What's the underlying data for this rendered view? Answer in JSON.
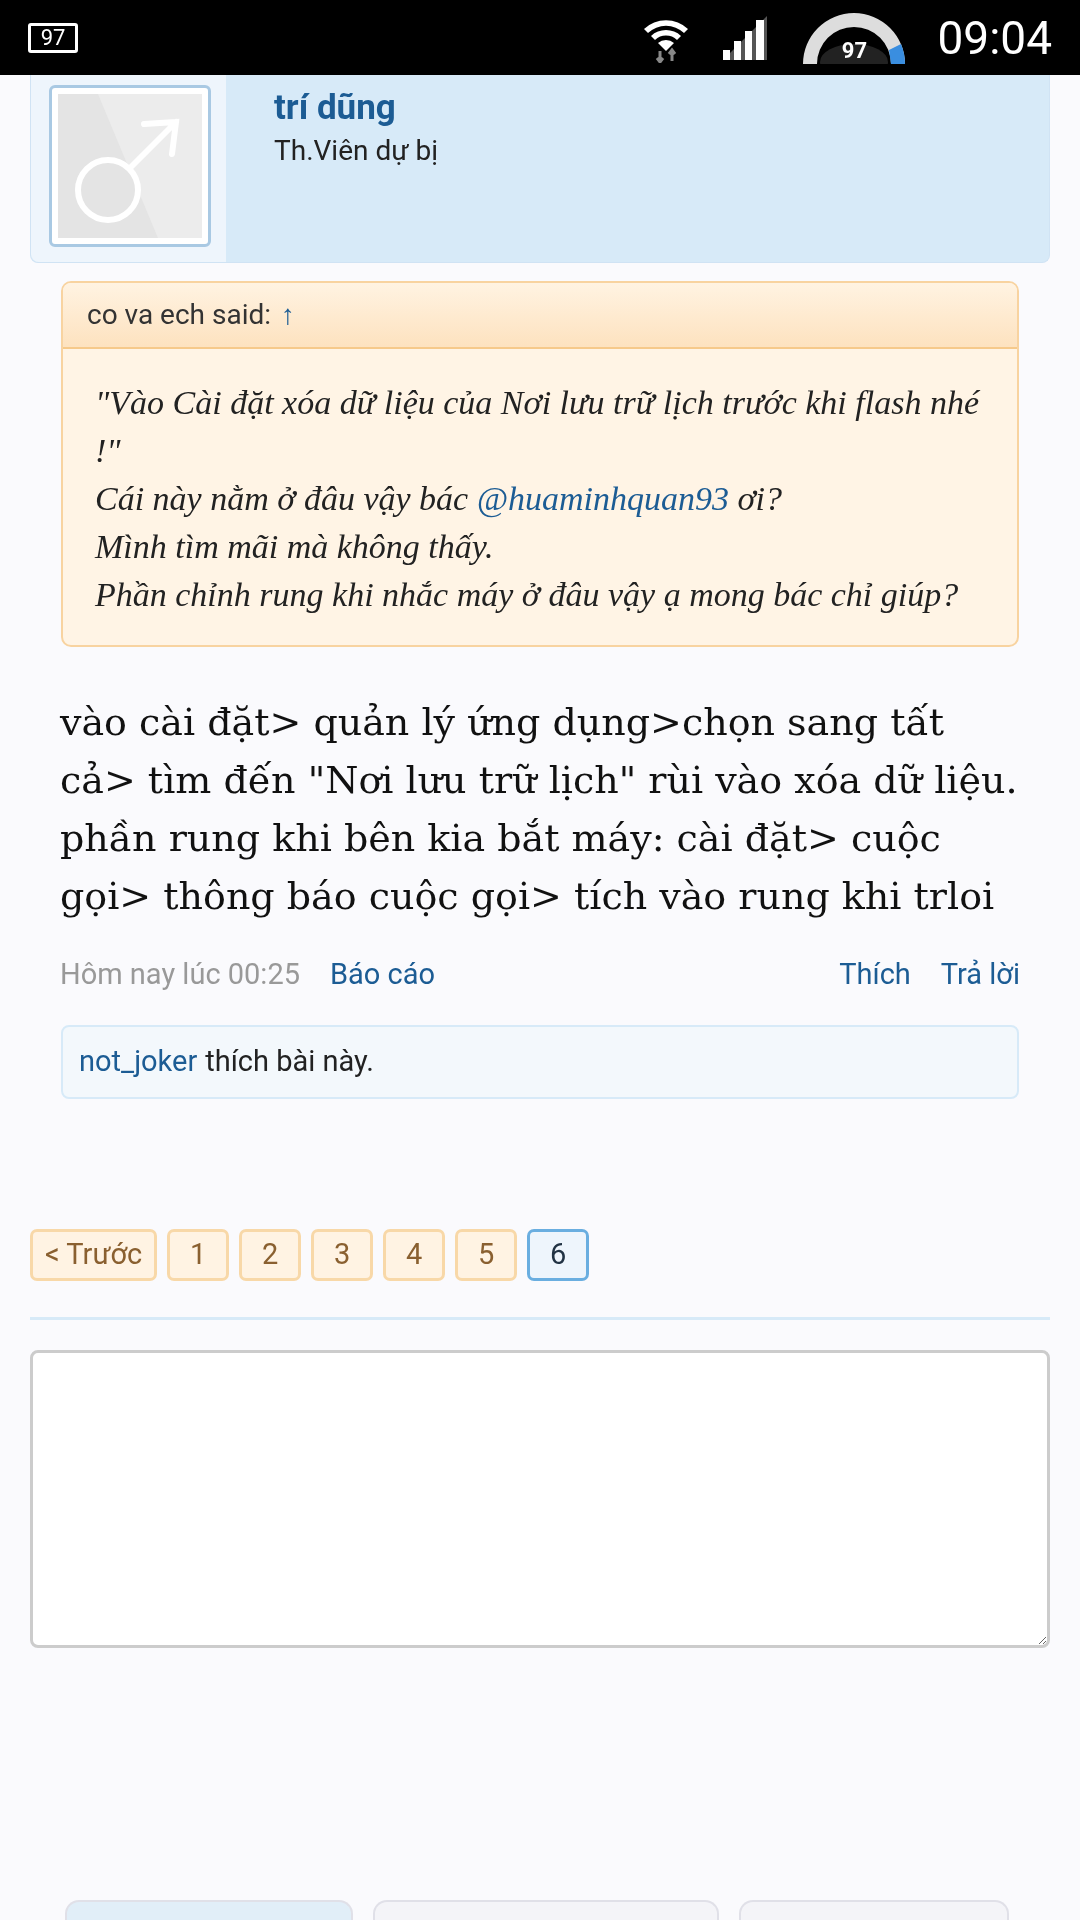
{
  "status_bar": {
    "battery": "97",
    "gauge": "97",
    "time": "09:04"
  },
  "author": {
    "name": "trí dũng",
    "title": "Th.Viên dự bị"
  },
  "quote": {
    "header": "co va ech said:",
    "jump": "↑",
    "lines": [
      "\"Vào Cài đặt xóa dữ liệu của Nơi lưu trữ lịch trước khi flash nhé !\""
    ],
    "mention_before": "Cái này nằm ở đâu vậy bác",
    "mention": "@huaminhquan93",
    "mention_after": "ơi?",
    "rest": [
      "Mình tìm mãi mà không thấy.",
      "Phần chỉnh rung khi nhắc máy ở đâu vậy ạ mong bác chỉ giúp?"
    ]
  },
  "message": [
    "vào cài đặt> quản lý ứng dụng>chọn sang tất cả> tìm đến \"Nơi lưu trữ lịch\" rùi vào xóa dữ liệu.",
    "phần rung khi bên kia bắt máy: cài đặt> cuộc gọi> thông báo cuộc gọi> tích vào rung khi trloi"
  ],
  "meta": {
    "date": "Hôm nay lúc 00:25",
    "report": "Báo cáo",
    "like": "Thích",
    "reply": "Trả lời"
  },
  "likes": {
    "user": "not_joker",
    "text": "thích bài này."
  },
  "pagination": [
    {
      "label": "< Trước",
      "selected": false
    },
    {
      "label": "1",
      "selected": false
    },
    {
      "label": "2",
      "selected": false
    },
    {
      "label": "3",
      "selected": false
    },
    {
      "label": "4",
      "selected": false
    },
    {
      "label": "5",
      "selected": false
    },
    {
      "label": "6",
      "selected": true
    }
  ],
  "reply_box": {
    "kind": "textarea"
  },
  "bottom_buttons": [
    {
      "kind": "primary"
    },
    {
      "kind": "secondary"
    },
    {
      "kind": "secondary"
    }
  ]
}
